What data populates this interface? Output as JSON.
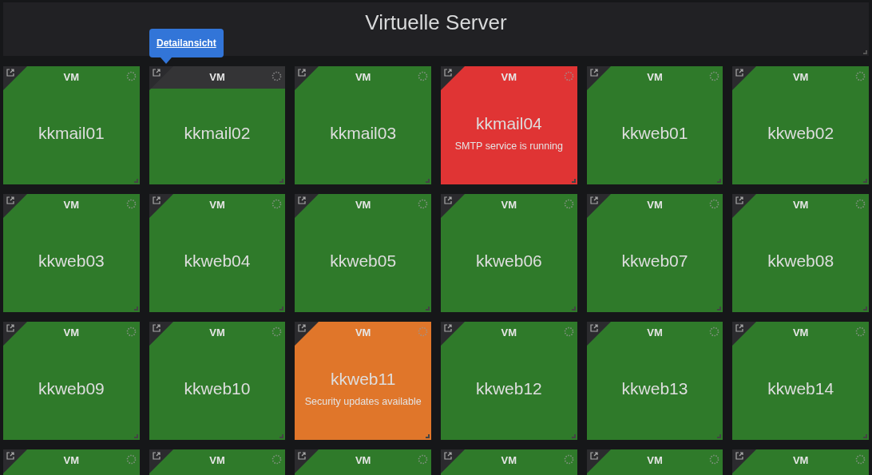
{
  "header": {
    "title": "Virtuelle Server"
  },
  "tooltip": {
    "link": "Detailansicht"
  },
  "tiles": [
    {
      "label": "VM",
      "name": "kkmail01",
      "color": "#2f7a2a",
      "hovered": false
    },
    {
      "label": "VM",
      "name": "kkmail02",
      "color": "#2f7a2a",
      "hovered": true
    },
    {
      "label": "VM",
      "name": "kkmail03",
      "color": "#2f7a2a",
      "hovered": false
    },
    {
      "label": "VM",
      "name": "kkmail04",
      "message": "SMTP service is running",
      "color": "#e03434",
      "hovered": false
    },
    {
      "label": "VM",
      "name": "kkweb01",
      "color": "#2f7a2a",
      "hovered": false
    },
    {
      "label": "VM",
      "name": "kkweb02",
      "color": "#2f7a2a",
      "hovered": false
    },
    {
      "label": "VM",
      "name": "kkweb03",
      "color": "#2f7a2a",
      "hovered": false
    },
    {
      "label": "VM",
      "name": "kkweb04",
      "color": "#2f7a2a",
      "hovered": false
    },
    {
      "label": "VM",
      "name": "kkweb05",
      "color": "#2f7a2a",
      "hovered": false
    },
    {
      "label": "VM",
      "name": "kkweb06",
      "color": "#2f7a2a",
      "hovered": false
    },
    {
      "label": "VM",
      "name": "kkweb07",
      "color": "#2f7a2a",
      "hovered": false
    },
    {
      "label": "VM",
      "name": "kkweb08",
      "color": "#2f7a2a",
      "hovered": false
    },
    {
      "label": "VM",
      "name": "kkweb09",
      "color": "#2f7a2a",
      "hovered": false
    },
    {
      "label": "VM",
      "name": "kkweb10",
      "color": "#2f7a2a",
      "hovered": false
    },
    {
      "label": "VM",
      "name": "kkweb11",
      "message": "Security updates available",
      "color": "#e0762a",
      "hovered": false
    },
    {
      "label": "VM",
      "name": "kkweb12",
      "color": "#2f7a2a",
      "hovered": false
    },
    {
      "label": "VM",
      "name": "kkweb13",
      "color": "#2f7a2a",
      "hovered": false
    },
    {
      "label": "VM",
      "name": "kkweb14",
      "color": "#2f7a2a",
      "hovered": false
    },
    {
      "label": "VM",
      "color": "#2f7a2a",
      "hovered": false
    },
    {
      "label": "VM",
      "color": "#2f7a2a",
      "hovered": false
    },
    {
      "label": "VM",
      "color": "#2f7a2a",
      "hovered": false
    },
    {
      "label": "VM",
      "color": "#2f7a2a",
      "hovered": false
    },
    {
      "label": "VM",
      "color": "#2f7a2a",
      "hovered": false
    },
    {
      "label": "VM",
      "color": "#2f7a2a",
      "hovered": false
    }
  ]
}
